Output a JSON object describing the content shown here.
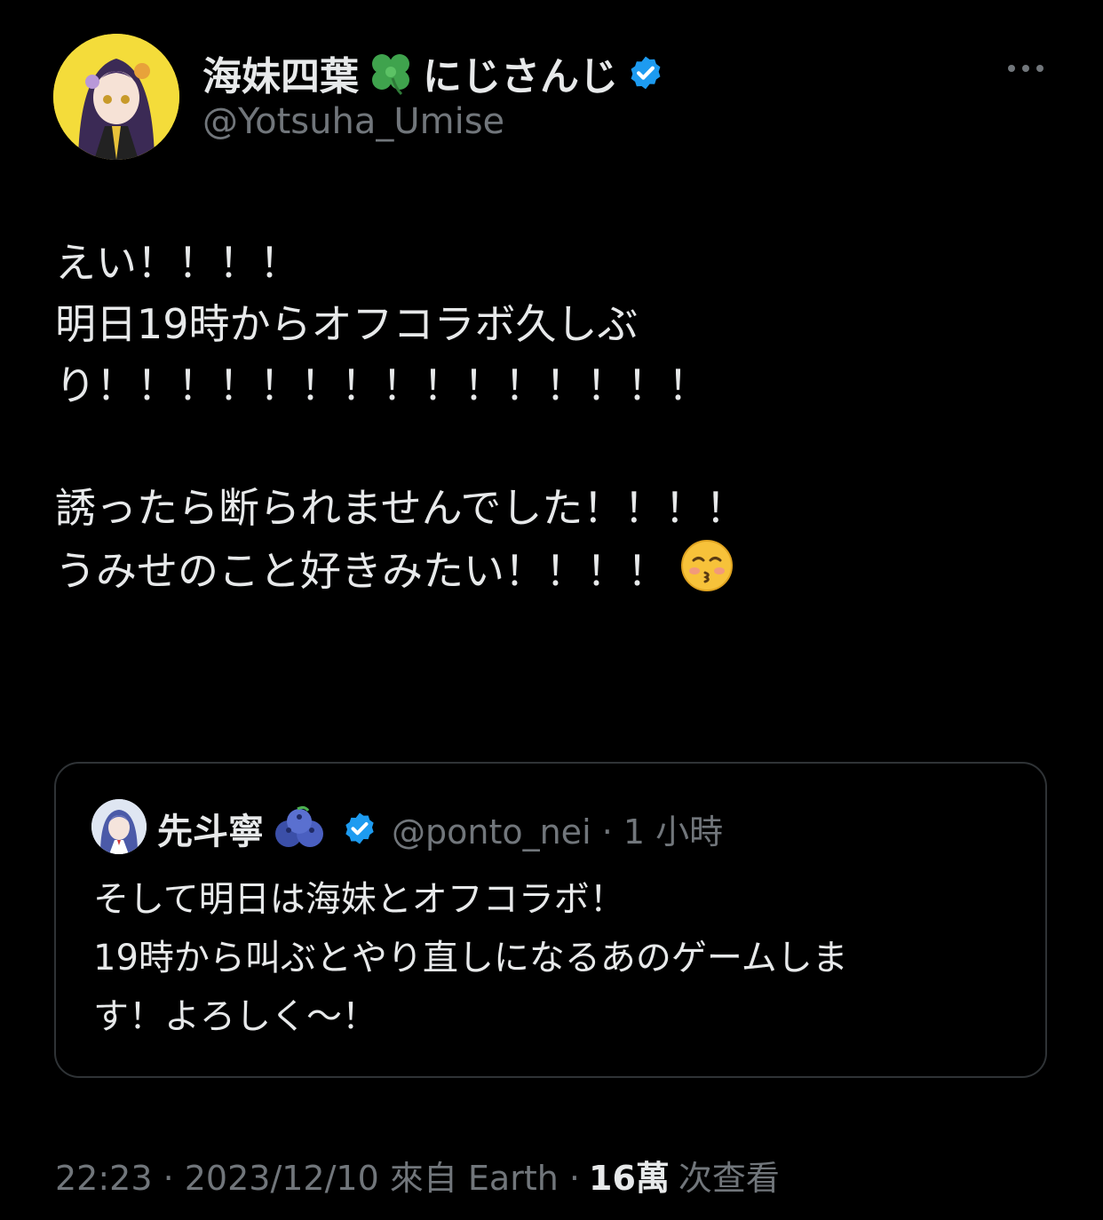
{
  "author": {
    "display_name": "海妹四葉",
    "name_suffix": "にじさんじ",
    "handle": "@Yotsuha_Umise",
    "avatar_icon": "avatar-icon",
    "clover_icon": "four-leaf-clover-icon",
    "verified_icon": "verified-badge-icon"
  },
  "more_icon": "more-options-icon",
  "tweet": {
    "lines": [
      "えい！！！！",
      "明日19時からオフコラボ久しぶ",
      "り！！！！！！！！！！！！！！！",
      "",
      "誘ったら断られませんでした！！！！",
      "うみせのこと好きみたい！！！！"
    ],
    "emoji": "kissing-face-icon"
  },
  "quote": {
    "display_name": "先斗寧",
    "emoji": "blueberries-icon",
    "handle_time": "@ponto_nei · 1 小時",
    "lines": [
      "そして明日は海妹とオフコラボ！",
      "19時から叫ぶとやり直しになるあのゲームしま",
      "す！よろしく～！"
    ]
  },
  "meta": {
    "timestamp_source": "22:23 · 2023/12/10 來自 Earth ·",
    "views_count": "16萬",
    "views_label": "次查看"
  },
  "colors": {
    "background": "#000000",
    "text": "#e7e9ea",
    "secondary": "#71767b",
    "border": "#2f3336",
    "verified": "#1d9bf0"
  }
}
